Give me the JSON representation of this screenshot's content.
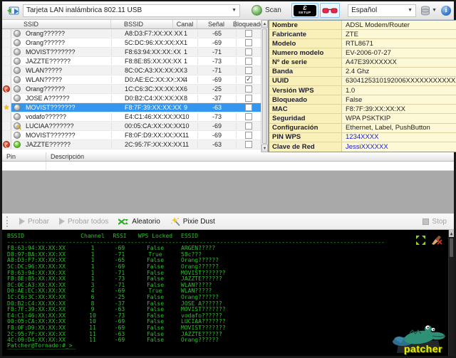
{
  "toolbar": {
    "adapter_label": "Tarjeta LAN inalámbrica 802.11 USB",
    "scan_label": "Scan",
    "wps_swoosh": "Ɛ",
    "wps_setup_label": "SETUP",
    "language_label": "Español"
  },
  "scan_table": {
    "headers": {
      "ssid": "SSID",
      "bssid": "BSSID",
      "canal": "Canal",
      "senal": "Señal",
      "bloqueado": "Bloqueado"
    },
    "rows": [
      {
        "ssid": "Orang??????",
        "bssid": "A8:D3:F7:XX:XX:XX",
        "canal": "1",
        "senal": "-65"
      },
      {
        "ssid": "Orang??????",
        "bssid": "5C:DC:96:XX:XX:XX",
        "canal": "1",
        "senal": "-69"
      },
      {
        "ssid": "MOVIST???????",
        "bssid": "F8:63:94:XX:XX:XX",
        "canal": "1",
        "senal": "-71"
      },
      {
        "ssid": "JAZZTE??????",
        "bssid": "F8:8E:85:XX:XX:XX",
        "canal": "1",
        "senal": "-73"
      },
      {
        "ssid": "WLAN?????",
        "bssid": "8C:0C:A3:XX:XX:XX",
        "canal": "3",
        "senal": "-71"
      },
      {
        "ssid": "WLAN?????",
        "bssid": "D0:AE:EC:XX:XX:XX",
        "canal": "4",
        "senal": "-69"
      },
      {
        "ssid": "Orang??????",
        "bssid": "1C:C6:3C:XX:XX:XX",
        "canal": "6",
        "senal": "-25"
      },
      {
        "ssid": "JOSE A??????",
        "bssid": "D0:B2:C4:XX:XX:XX",
        "canal": "8",
        "senal": "-37"
      },
      {
        "ssid": "MOVIST???????",
        "bssid": "F8:7F:39:XX:XX:XX",
        "canal": "9",
        "senal": "-63"
      },
      {
        "ssid": "vodafo??????",
        "bssid": "E4:C1:46:XX:XX:XX",
        "canal": "10",
        "senal": "-73"
      },
      {
        "ssid": "LUCIAA???????",
        "bssid": "00:05:CA:XX:XX:XX",
        "canal": "10",
        "senal": "-69"
      },
      {
        "ssid": "MOVIST???????",
        "bssid": "F8:0F:D9:XX:XX:XX",
        "canal": "11",
        "senal": "-69"
      },
      {
        "ssid": "JAZZTE??????",
        "bssid": "2C:95:7F:XX:XX:XX",
        "canal": "11",
        "senal": "-63"
      }
    ]
  },
  "details": {
    "rows": [
      {
        "label": "Nombre",
        "value": "ADSL Modem/Router"
      },
      {
        "label": "Fabricante",
        "value": "ZTE"
      },
      {
        "label": "Modelo",
        "value": "RTL8671"
      },
      {
        "label": "Numero modelo",
        "value": "EV-2006-07-27"
      },
      {
        "label": "Nº de serie",
        "value": "A47E39XXXXXX"
      },
      {
        "label": "Banda",
        "value": "2.4 Ghz"
      },
      {
        "label": "UUID",
        "value": "6304125310192006XXXXXXXXXXXXXXXX"
      },
      {
        "label": "Versión WPS",
        "value": "1.0"
      },
      {
        "label": "Bloqueado",
        "value": "False"
      },
      {
        "label": "MAC",
        "value": "F8:7F:39:XX:XX:XX"
      },
      {
        "label": "Seguridad",
        "value": "WPA PSKTKIP"
      },
      {
        "label": "Configuración",
        "value": "Ethernet, Label, PushButton"
      },
      {
        "label": "PIN WPS",
        "value": "1234XXXX"
      },
      {
        "label": "Clave de Red",
        "value": "JessiXXXXXX"
      }
    ]
  },
  "pin_table": {
    "pin_header": "Pin",
    "desc_header": "Descripción"
  },
  "actions": {
    "probar": "Probar",
    "probar_todos": "Probar todos",
    "aleatorio": "Aleatorio",
    "pixie_dust": "Pixie Dust",
    "stop": "Stop"
  },
  "terminal": {
    "headers": [
      "BSSID",
      "Channel",
      "RSSI",
      "WPS Locked",
      "ESSID"
    ],
    "separator": "--------------------------------------------------------------------------------------------------------------",
    "rows": [
      [
        "F8:63:94:XX:XX:XX",
        "1",
        "-69",
        "False",
        "ARGEN?????"
      ],
      [
        "D8:97:BA:XX:XX:XX",
        "1",
        "-71",
        "True",
        "58c???"
      ],
      [
        "A8:D3:F7:XX:XX:XX",
        "1",
        "-65",
        "False",
        "Orang??????"
      ],
      [
        "5C:DC:96:XX:XX:XX",
        "1",
        "-69",
        "False",
        "Orang??????"
      ],
      [
        "F8:63:94:XX:XX:XX",
        "1",
        "-71",
        "False",
        "MOVIST???????"
      ],
      [
        "F8:8E:85:XX:XX:XX",
        "1",
        "-73",
        "False",
        "JAZZTE??????"
      ],
      [
        "8C:0C:A3:XX:XX:XX",
        "3",
        "-71",
        "False",
        "WLAN?????"
      ],
      [
        "D0:AE:EC:XX:XX:XX",
        "4",
        "-69",
        "True",
        "WLAN?????"
      ],
      [
        "1C:C6:3C:XX:XX:XX",
        "6",
        "-25",
        "False",
        "Orang??????"
      ],
      [
        "D0:B2:C4:XX:XX:XX",
        "8",
        "-37",
        "False",
        "JOSE A??????"
      ],
      [
        "F8:7F:39:XX:XX:XX",
        "9",
        "-63",
        "False",
        "MOVIST???????"
      ],
      [
        "E4:C1:46:XX:XX:XX",
        "10",
        "-73",
        "False",
        "vodafo??????"
      ],
      [
        "00:05:CA:XX:XX:XX",
        "10",
        "-69",
        "False",
        "LUCIAA???????"
      ],
      [
        "F8:0F:D9:XX:XX:XX",
        "11",
        "-69",
        "False",
        "MOVIST???????"
      ],
      [
        "2C:95:7F:XX:XX:XX",
        "11",
        "-63",
        "False",
        "JAZZTE??????"
      ],
      [
        "4C:09:D4:XX:XX:XX",
        "11",
        "-69",
        "False",
        "Orang??????"
      ]
    ],
    "prompt": "Patcher@Tornado:#_>"
  },
  "logo": {
    "text": "patcher"
  }
}
